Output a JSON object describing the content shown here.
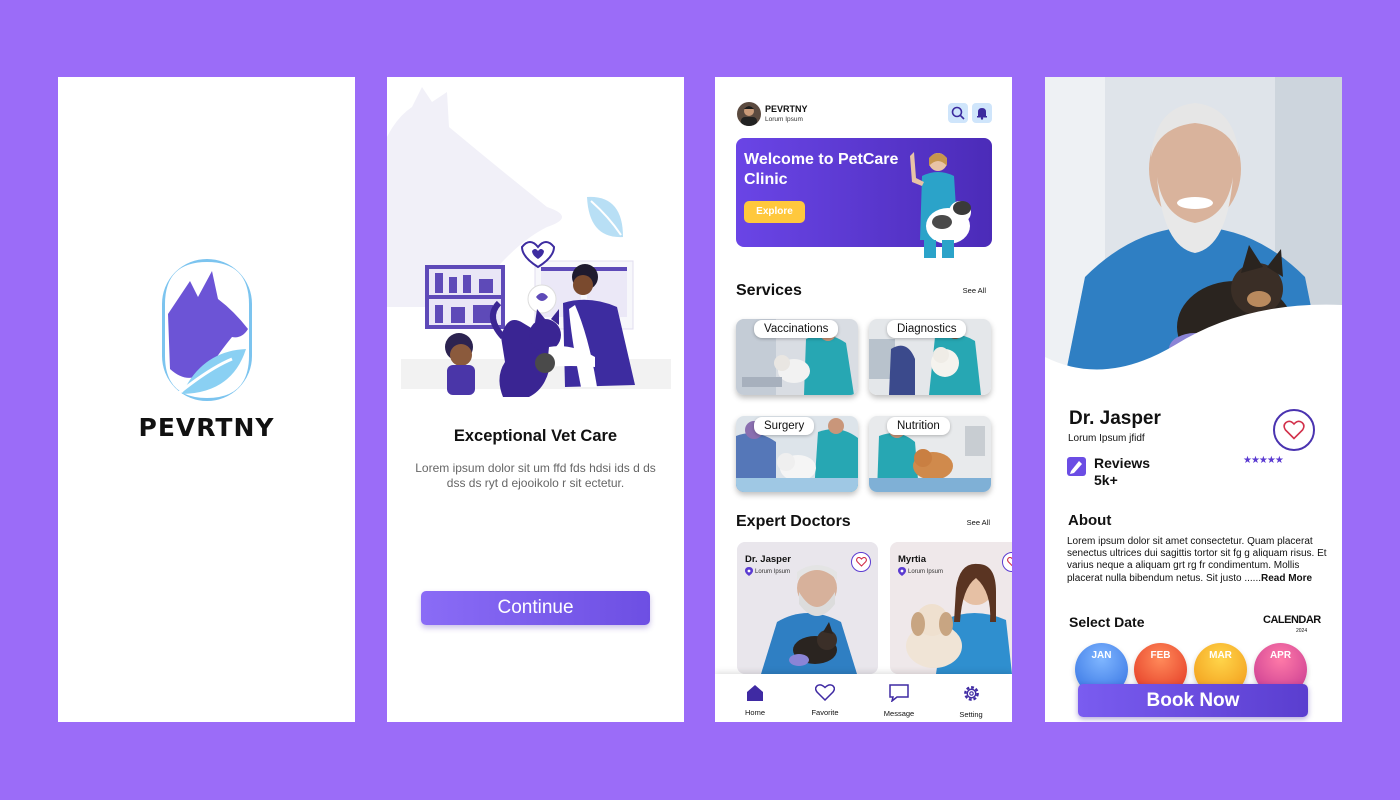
{
  "colors": {
    "background": "#9b6cf8",
    "primary": "#6b4de4",
    "accent": "#ffc83d"
  },
  "splash": {
    "brand": "PEVRTNY"
  },
  "onboarding": {
    "title": "Exceptional Vet Care",
    "text": "Lorem ipsum dolor sit um ffd fds hdsi ids d ds dss ds ryt  d ejooikolo r sit ectetur.",
    "continue_label": "Continue"
  },
  "home": {
    "app_name": "PEVRTNY",
    "app_sub": "Lorum Ipsum",
    "banner_title": "Welcome to PetCare Clinic",
    "explore_label": "Explore",
    "services_title": "Services",
    "see_all": "See All",
    "services": [
      {
        "label": "Vaccinations"
      },
      {
        "label": "Diagnostics"
      },
      {
        "label": "Surgery"
      },
      {
        "label": "Nutrition"
      }
    ],
    "doctors_title": "Expert Doctors",
    "doctors": [
      {
        "name": "Dr. Jasper",
        "location": "Lorum Ipsum"
      },
      {
        "name": "Myrtia",
        "location": "Lorum Ipsum"
      }
    ],
    "nav": [
      {
        "label": "Home",
        "icon": "home-icon"
      },
      {
        "label": "Favorite",
        "icon": "heart-icon"
      },
      {
        "label": "Message",
        "icon": "message-icon"
      },
      {
        "label": "Setting",
        "icon": "gear-icon"
      }
    ]
  },
  "doctor": {
    "name": "Dr. Jasper",
    "sub": "Lorum Ipsum jfidf",
    "reviews_label": "Reviews",
    "reviews_count": "5k+",
    "stars": "★★★★★",
    "about_title": "About",
    "about_text": "Lorem ipsum dolor sit amet consectetur. Quam placerat senectus ultrices dui sagittis tortor sit fg g aliquam risus. Et varius neque a aliquam grt rg fr condimentum. Mollis placerat nulla bibendum netus. Sit justo ......",
    "read_more": "Read More",
    "select_date": "Select Date",
    "calendar_title": "CALENDAR",
    "calendar_year": "2024",
    "months": [
      "JAN",
      "FEB",
      "MAR",
      "APR"
    ],
    "book_label": "Book Now"
  }
}
